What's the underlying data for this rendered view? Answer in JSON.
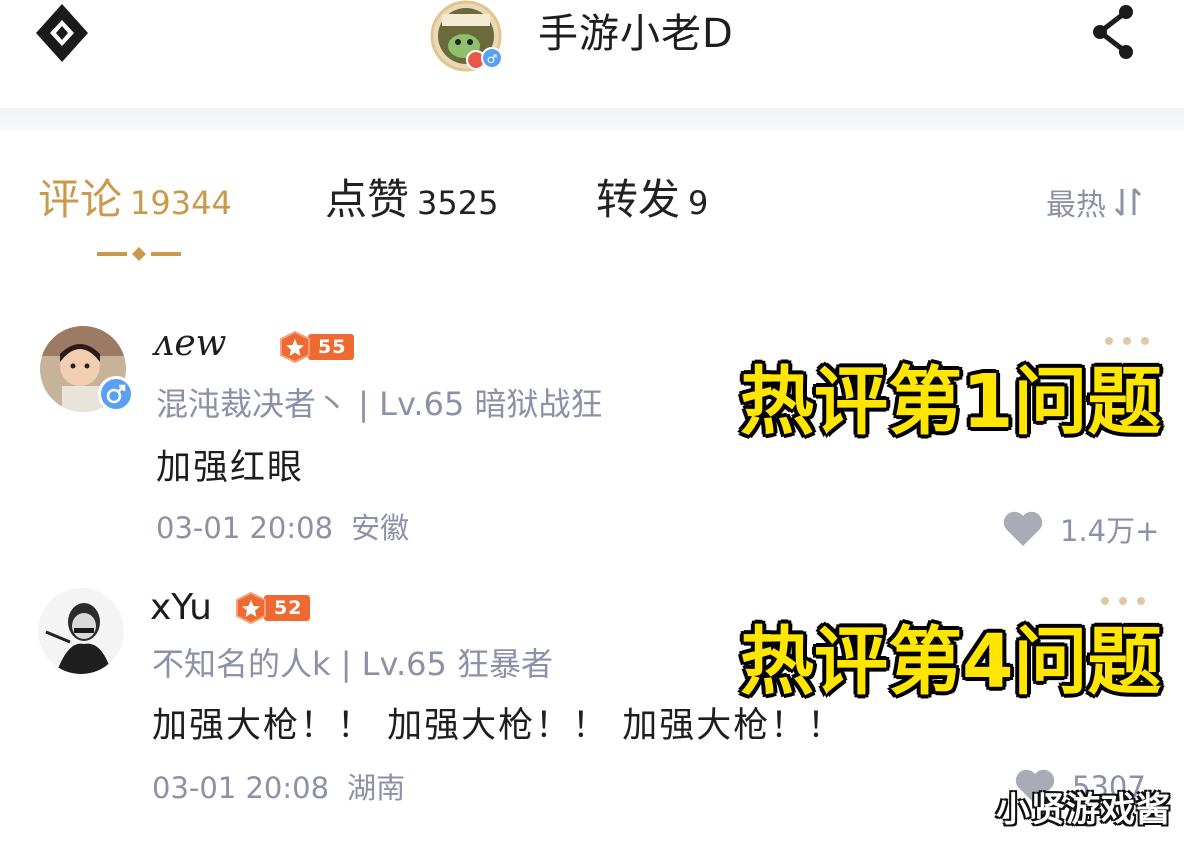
{
  "header": {
    "author_name": "手游小老D",
    "back_icon": "back-diamond-icon",
    "share_icon": "share-icon"
  },
  "tabs": [
    {
      "label": "评论",
      "count": "19344",
      "active": true
    },
    {
      "label": "点赞",
      "count": "3525",
      "active": false
    },
    {
      "label": "转发",
      "count": "9",
      "active": false
    }
  ],
  "sort": {
    "label": "最热",
    "icon": "sort-arrows-icon"
  },
  "colors": {
    "accent_gold": "#c99a4c",
    "meta_gray": "#8b91a8",
    "level_badge": "#ef6a33",
    "caption_yellow": "#ffe600",
    "gender_blue": "#5aa0f2"
  },
  "comments": [
    {
      "user_name": "ᴧew",
      "level": "55",
      "user_title": "混沌裁决者丶 | Lv.65 暗狱战狂",
      "text": "加强红眼",
      "date": "03-01 20:08",
      "region": "安徽",
      "likes": "1.4万+",
      "overlay_caption": "热评第1问题"
    },
    {
      "user_name": "xYu",
      "level": "52",
      "user_title": "不知名的人k | Lv.65 狂暴者",
      "text": "加强大枪！！ 加强大枪！！ 加强大枪！！",
      "date": "03-01 20:08",
      "region": "湖南",
      "likes": "5307",
      "overlay_caption": "热评第4问题"
    }
  ],
  "watermark": "小贤游戏酱"
}
